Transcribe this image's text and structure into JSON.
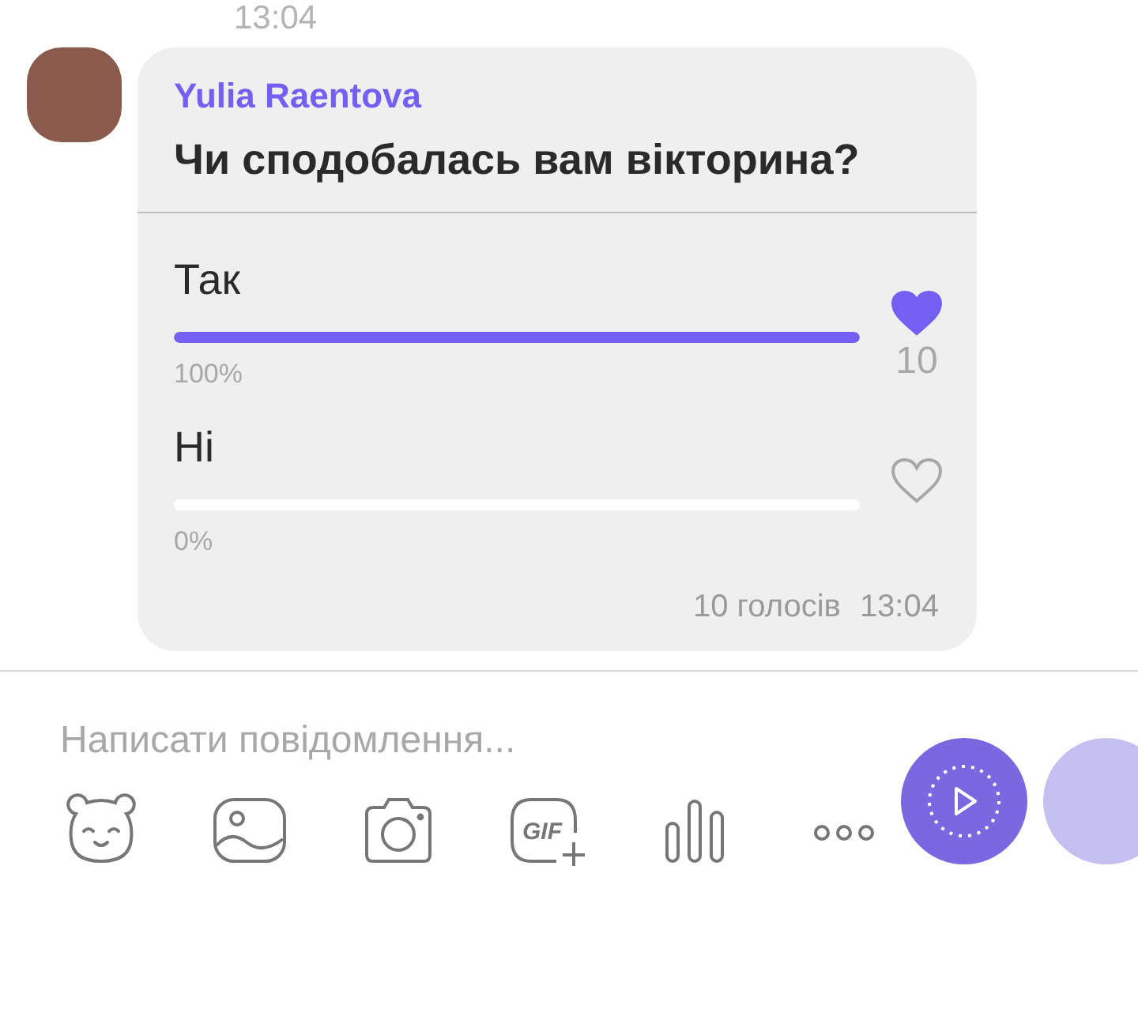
{
  "previous_time": "13:04",
  "message": {
    "sender": "Yulia Raentova",
    "poll": {
      "question": "Чи сподобалась вам вікторина?",
      "options": [
        {
          "label": "Так",
          "level": 1,
          "percent": "100%",
          "liked": true,
          "count": "10"
        },
        {
          "label": "Ні",
          "level": 0,
          "percent": "0%",
          "liked": false
        }
      ],
      "votes": "10 голосів",
      "time": "13:04"
    }
  },
  "composer": {
    "placeholder": "Написати повідомлення...",
    "gif_label": "GIF"
  }
}
